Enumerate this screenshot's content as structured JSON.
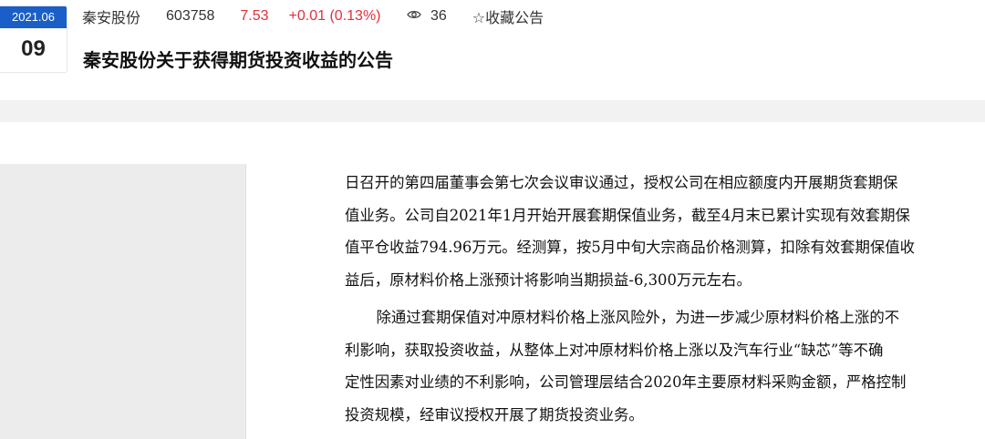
{
  "header": {
    "date_month": "2021.06",
    "date_day": "09",
    "stock_name": "秦安股份",
    "stock_code": "603758",
    "price": "7.53",
    "change": "+0.01 (0.13%)",
    "views": "36",
    "favorite_label": "☆收藏公告",
    "title": "秦安股份关于获得期货投资收益的公告"
  },
  "content": {
    "paragraph1_lines": [
      "日召开的第四届董事会第七次会议审议通过，授权公司在相应额度内开展期货套期保",
      "值业务。公司自2021年1月开始开展套期保值业务，截至4月末已累计实现有效套期保",
      "值平仓收益794.96万元。经测算，按5月中旬大宗商品价格测算，扣除有效套期保值收",
      "益后，原材料价格上涨预计将影响当期损益-6,300万元左右。"
    ],
    "paragraph2_lines": [
      "除通过套期保值对冲原材料价格上涨风险外，为进一步减少原材料价格上涨的不",
      "利影响，获取投资收益，从整体上对冲原材料价格上涨以及汽车行业“缺芯”等不确",
      "定性因素对业绩的不利影响，公司管理层结合2020年主要原材料采购金额，严格控制",
      "投资规模，经审议授权开展了期货投资业务。"
    ]
  },
  "colors": {
    "date_header_bg": "#1a5fc7",
    "price_up": "#e0303b"
  }
}
